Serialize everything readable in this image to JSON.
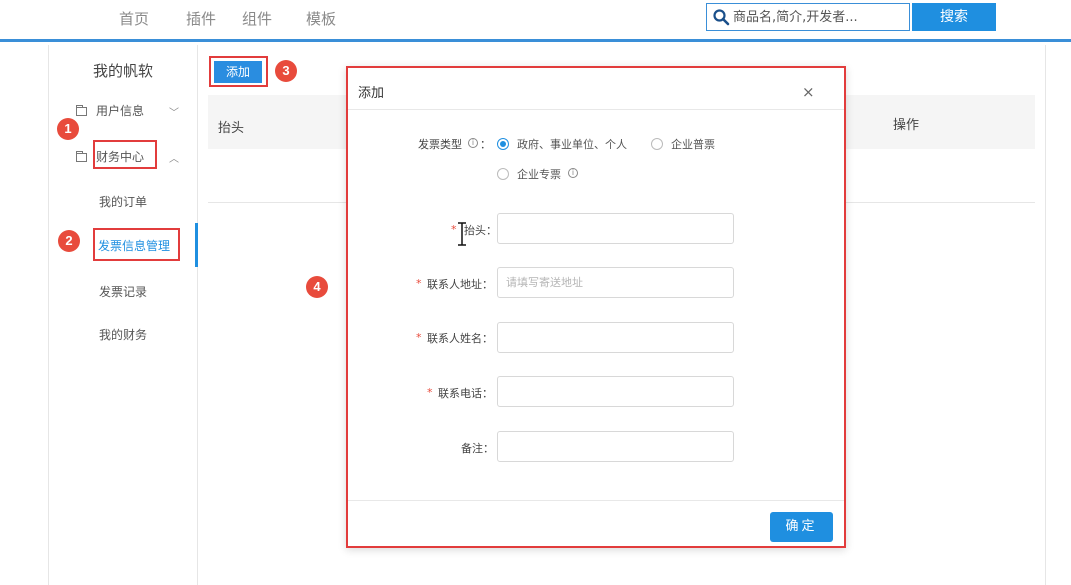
{
  "nav": {
    "items": [
      "首页",
      "插件",
      "组件",
      "模板"
    ],
    "search_placeholder": "商品名,简介,开发者...",
    "search_button": "搜索"
  },
  "sidebar": {
    "title": "我的帆软",
    "groups": [
      {
        "label": "用户信息",
        "chevron": "﹀"
      },
      {
        "label": "财务中心",
        "chevron": "︿"
      }
    ],
    "items": [
      "我的订单",
      "发票信息管理",
      "发票记录",
      "我的财务"
    ]
  },
  "main": {
    "add_button": "添加",
    "columns": [
      "抬头",
      "操作"
    ]
  },
  "badges": [
    "1",
    "2",
    "3",
    "4"
  ],
  "modal": {
    "title": "添加",
    "close": "×",
    "invoice_type_label": "发票类型",
    "info_glyph": "i",
    "colon": "：",
    "invoice_options": [
      "政府、事业单位、个人",
      "企业普票",
      "企业专票"
    ],
    "required_mark": "*",
    "fields": [
      {
        "label": "抬头：",
        "required": true,
        "placeholder": "",
        "value": ""
      },
      {
        "label": "联系人地址：",
        "required": true,
        "placeholder": "请填写寄送地址",
        "value": ""
      },
      {
        "label": "联系人姓名：",
        "required": true,
        "placeholder": "",
        "value": ""
      },
      {
        "label": "联系电话：",
        "required": true,
        "placeholder": "",
        "value": ""
      },
      {
        "label": "备注：",
        "required": false,
        "placeholder": "",
        "value": ""
      }
    ],
    "confirm_button": "确定"
  },
  "colors": {
    "accent": "#1f8fe0",
    "annotation": "#e23c3c",
    "badge": "#e84b3c"
  }
}
